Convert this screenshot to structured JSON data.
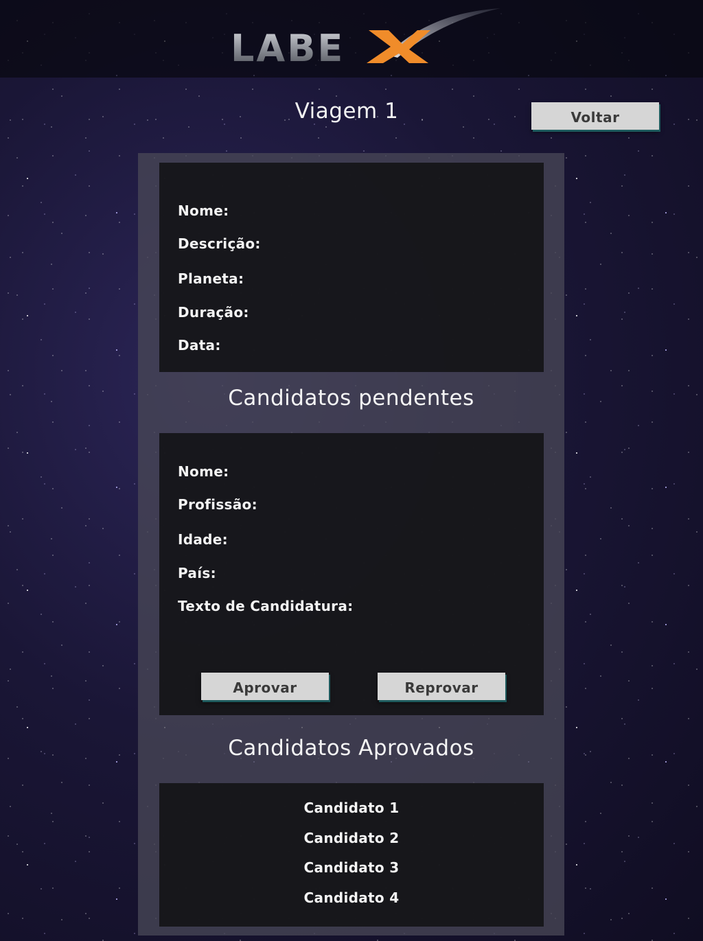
{
  "header": {
    "logo_text": "LABEX",
    "logo_part_1": "LABE",
    "logo_part_2": "X"
  },
  "page": {
    "title": "Viagem 1",
    "back_label": "Voltar"
  },
  "trip_details": {
    "fields": [
      {
        "label": "Nome:"
      },
      {
        "label": "Descrição:"
      },
      {
        "label": "Planeta:"
      },
      {
        "label": "Duração:"
      },
      {
        "label": "Data:"
      }
    ]
  },
  "pending": {
    "title": "Candidatos pendentes",
    "fields": [
      {
        "label": "Nome:"
      },
      {
        "label": "Profissão:"
      },
      {
        "label": "Idade:"
      },
      {
        "label": "País:"
      },
      {
        "label": "Texto de Candidatura:"
      }
    ],
    "approve_label": "Aprovar",
    "reject_label": "Reprovar"
  },
  "approved": {
    "title": "Candidatos Aprovados",
    "items": [
      "Candidato 1",
      "Candidato 2",
      "Candidato 3",
      "Candidato 4"
    ]
  },
  "colors": {
    "button_bg": "#d6d6d6",
    "button_shadow": "#1e5b5e",
    "panel_bg": "#141418",
    "logo_accent": "#f08c2a"
  }
}
